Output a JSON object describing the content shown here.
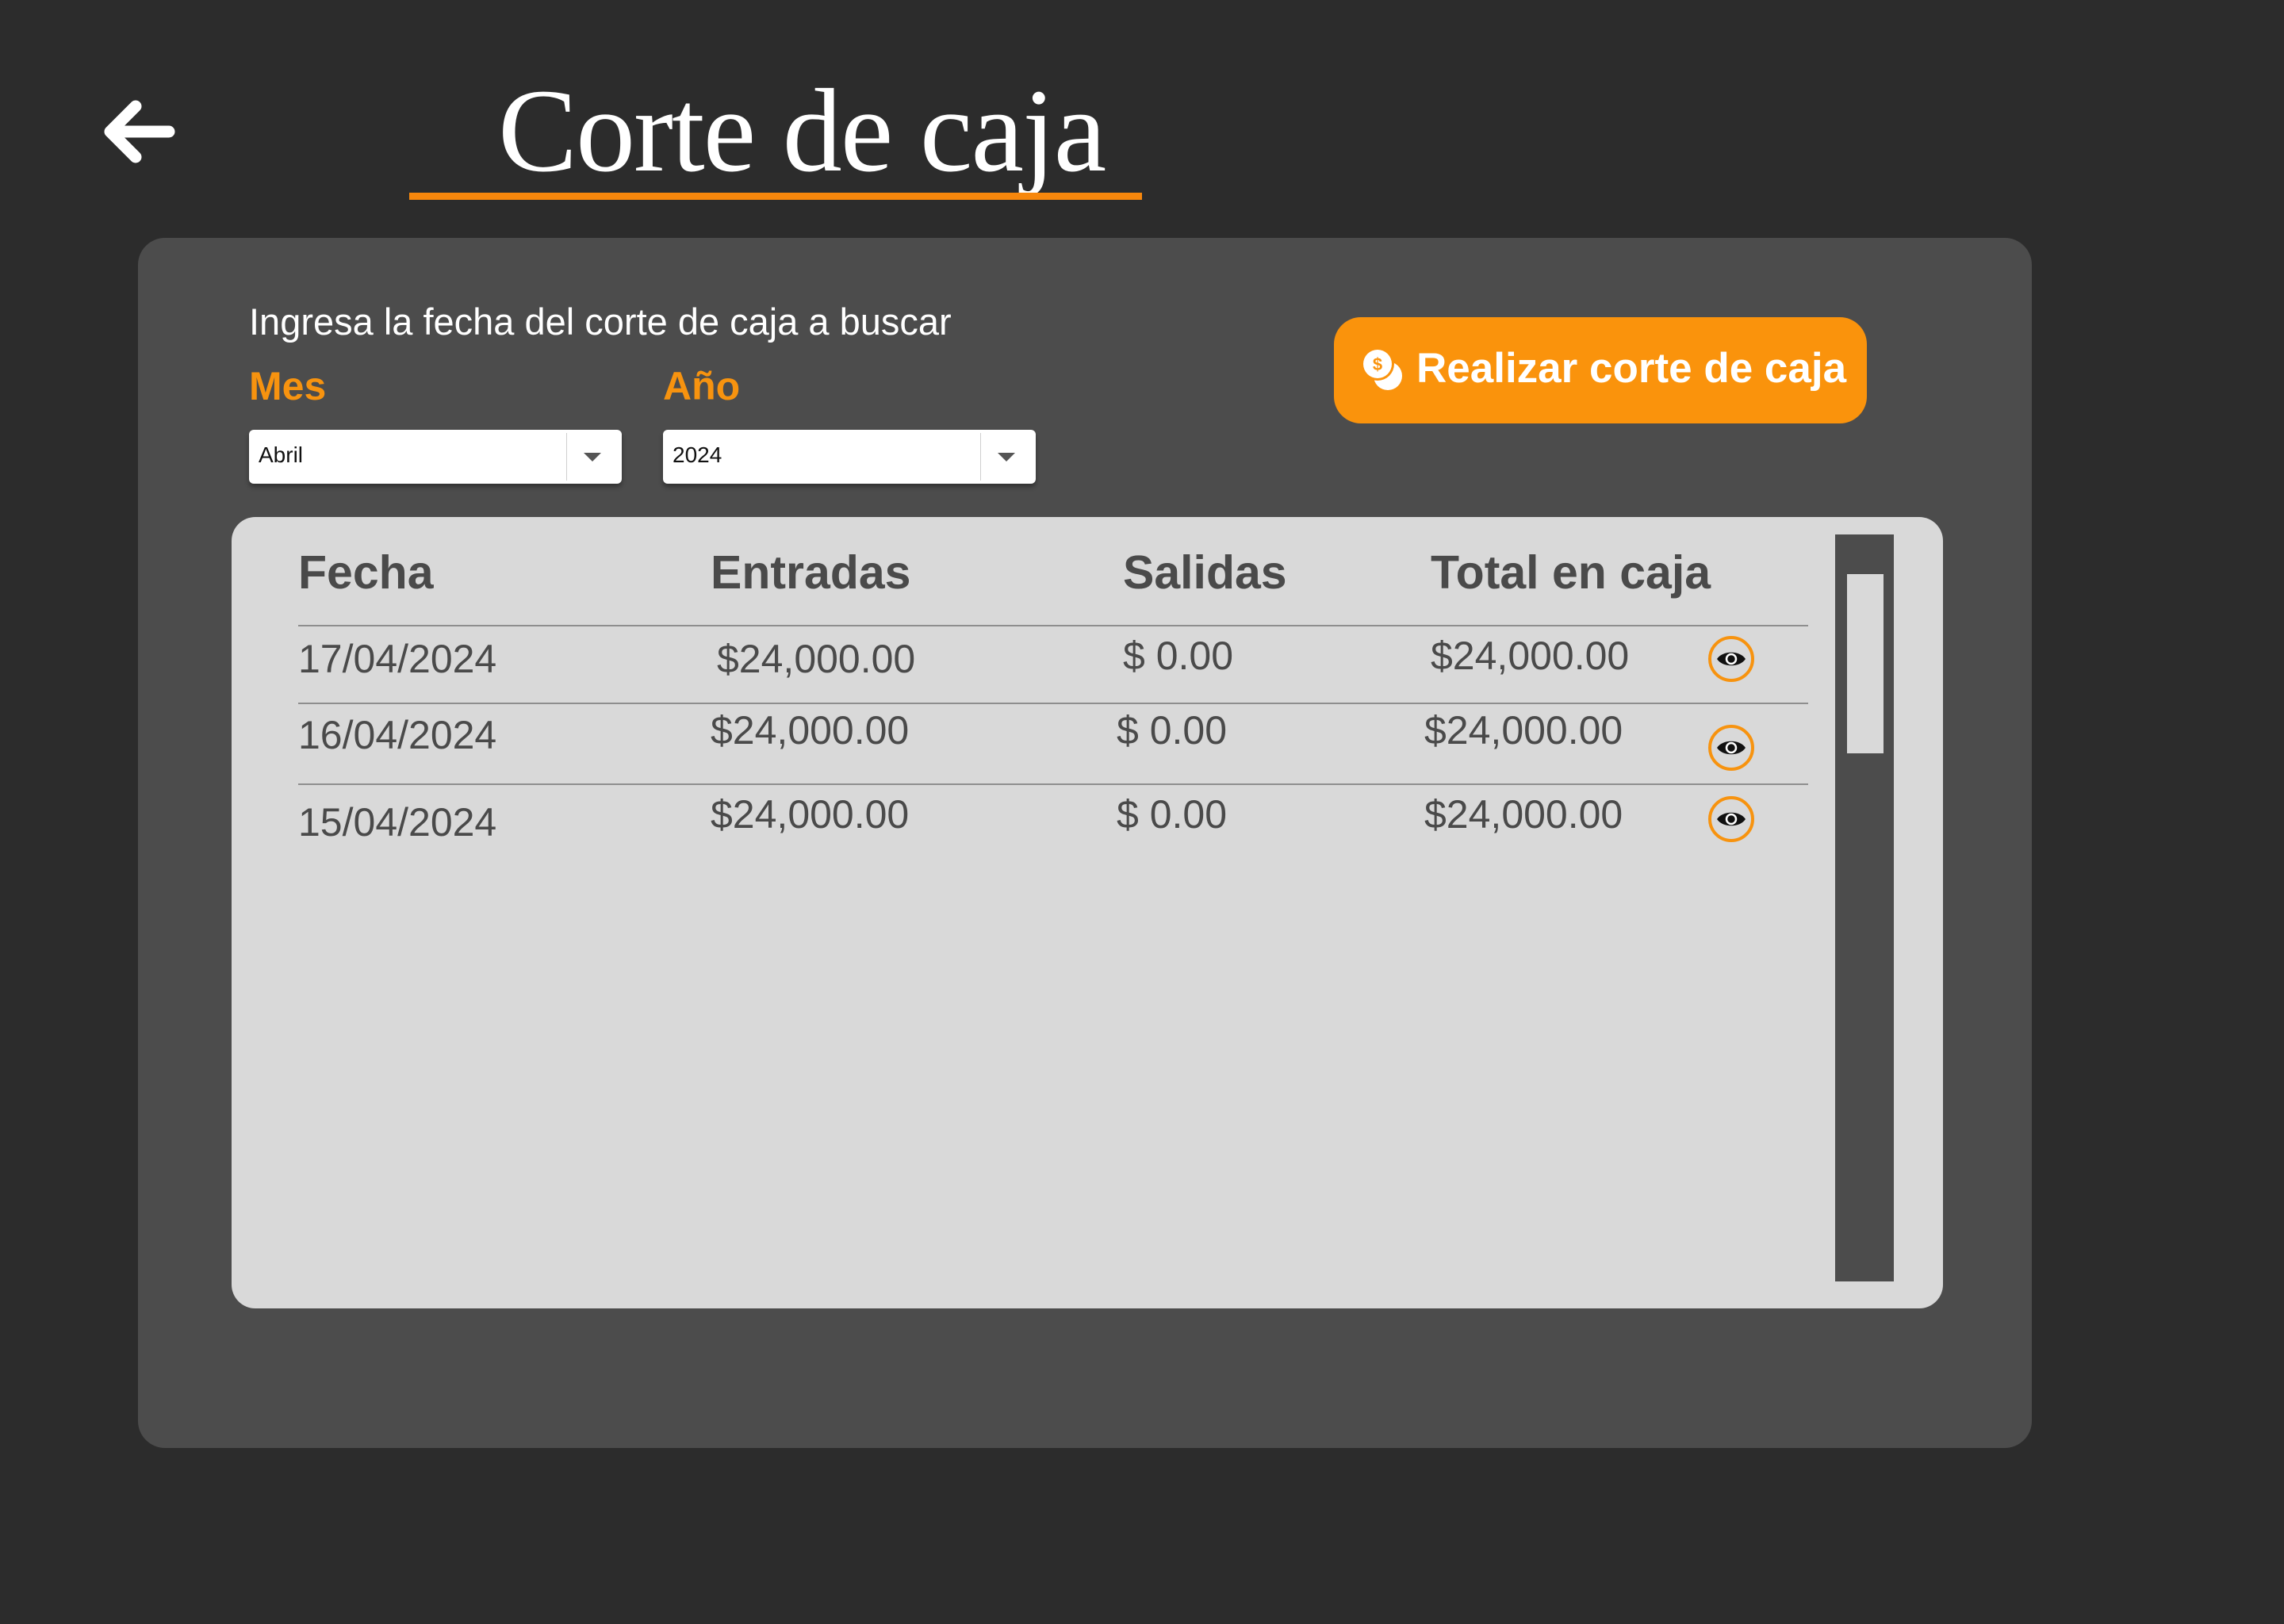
{
  "header": {
    "back_icon": "arrow-left-icon",
    "title": "Corte de caja"
  },
  "filters": {
    "prompt": "Ingresa la fecha del corte de caja a buscar",
    "month": {
      "label": "Mes",
      "value": "Abril"
    },
    "year": {
      "label": "Año",
      "value": "2024"
    }
  },
  "actions": {
    "cash_cut_button": {
      "label": "Realizar corte de caja",
      "icon": "coins-icon"
    }
  },
  "table": {
    "columns": [
      "Fecha",
      "Entradas",
      "Salidas",
      "Total en caja"
    ],
    "rows": [
      {
        "fecha": "17/04/2024",
        "entradas": "$24,000.00",
        "salidas": "$ 0.00",
        "total": "$24,000.00",
        "action_icon": "eye-icon"
      },
      {
        "fecha": "16/04/2024",
        "entradas": "$24,000.00",
        "salidas": "$ 0.00",
        "total": "$24,000.00",
        "action_icon": "eye-icon"
      },
      {
        "fecha": "15/04/2024",
        "entradas": "$24,000.00",
        "salidas": "$ 0.00",
        "total": "$24,000.00",
        "action_icon": "eye-icon"
      }
    ]
  },
  "colors": {
    "background": "#2c2c2c",
    "panel": "#4c4c4c",
    "table": "#d9d9d9",
    "accent": "#f7930f",
    "button": "#fa930c"
  }
}
